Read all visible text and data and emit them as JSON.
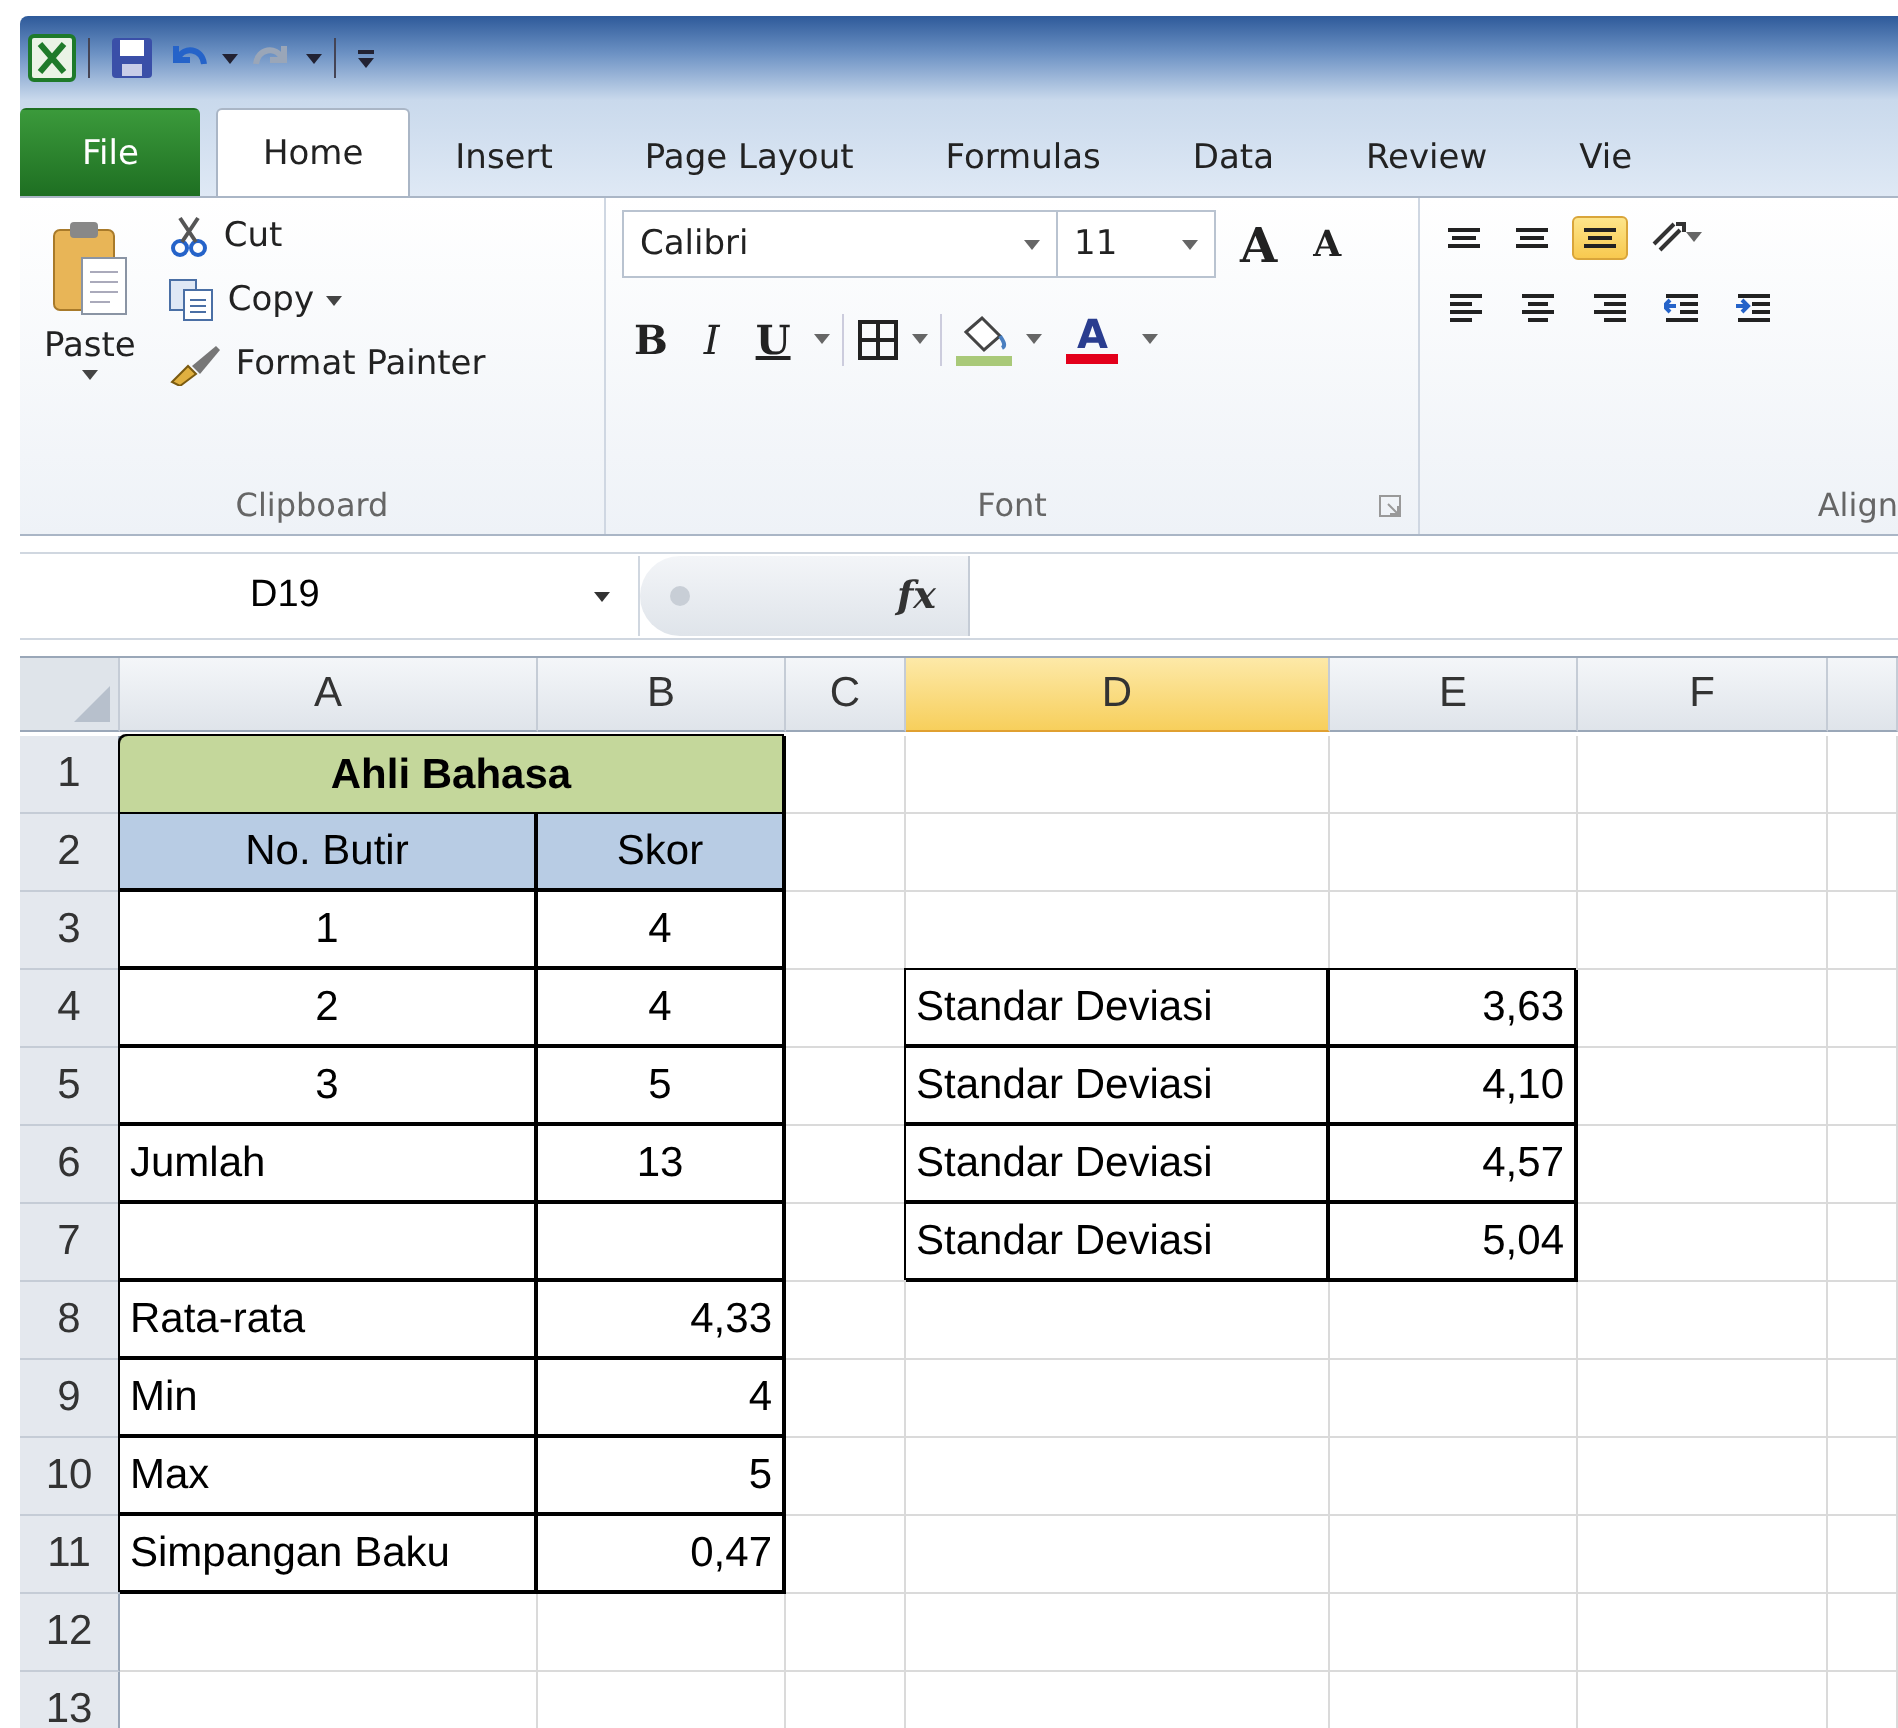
{
  "quick_access": [
    {
      "kind": "app"
    },
    {
      "kind": "save"
    },
    {
      "kind": "undo"
    },
    {
      "kind": "dropdown"
    },
    {
      "kind": "redo"
    },
    {
      "kind": "dropdown"
    },
    {
      "kind": "customize"
    }
  ],
  "tabs": [
    {
      "label": "File",
      "kind": "file",
      "selected": false
    },
    {
      "label": "Home",
      "kind": "tab",
      "selected": true
    },
    {
      "label": "Insert",
      "kind": "tab",
      "selected": false
    },
    {
      "label": "Page Layout",
      "kind": "tab",
      "selected": false
    },
    {
      "label": "Formulas",
      "kind": "tab",
      "selected": false
    },
    {
      "label": "Data",
      "kind": "tab",
      "selected": false
    },
    {
      "label": "Review",
      "kind": "tab",
      "selected": false
    },
    {
      "label": "Vie",
      "kind": "tab",
      "selected": false
    }
  ],
  "clipboard": {
    "title": "Clipboard",
    "paste": "Paste",
    "items": [
      {
        "kind": "cut",
        "label": "Cut"
      },
      {
        "kind": "copy",
        "label": "Copy"
      },
      {
        "kind": "painter",
        "label": "Format Painter"
      }
    ]
  },
  "font": {
    "title": "Font",
    "name": "Calibri",
    "size": "11",
    "grow": "A",
    "shrink": "A",
    "bold": "B",
    "italic": "I",
    "underline": "U",
    "color_label": "A"
  },
  "alignment": {
    "title": "Align",
    "top_row": [
      {
        "kind": "top",
        "on": false
      },
      {
        "kind": "middle",
        "on": false
      },
      {
        "kind": "bottom",
        "on": true
      },
      {
        "kind": "orientation",
        "on": false
      }
    ],
    "bottom_row": [
      {
        "kind": "left",
        "on": false
      },
      {
        "kind": "center",
        "on": false
      },
      {
        "kind": "right",
        "on": false
      },
      {
        "kind": "outdent",
        "on": false
      },
      {
        "kind": "indent",
        "on": false
      }
    ]
  },
  "formula_bar": {
    "name_box": "D19",
    "function_label": "fx"
  },
  "sheet": {
    "columns": [
      {
        "label": "A",
        "selected": false
      },
      {
        "label": "B",
        "selected": false
      },
      {
        "label": "C",
        "selected": false
      },
      {
        "label": "D",
        "selected": true
      },
      {
        "label": "E",
        "selected": false
      },
      {
        "label": "F",
        "selected": false
      },
      {
        "selected": false
      }
    ],
    "rows": [
      {
        "number": "1",
        "cells": [
          {
            "kind": "title",
            "text": "Ahli Bahasa",
            "centered": true,
            "merged": true
          },
          {
            "kind": "plain"
          },
          {
            "kind": "plain"
          },
          {
            "kind": "plain"
          },
          {
            "kind": "plain"
          },
          {
            "kind": "plain"
          }
        ]
      },
      {
        "number": "2",
        "cells": [
          {
            "kind": "header",
            "text": "No. Butir",
            "centered": true
          },
          {
            "kind": "header",
            "text": "Skor",
            "centered": true
          },
          {
            "kind": "plain"
          },
          {
            "kind": "plain"
          },
          {
            "kind": "plain"
          },
          {
            "kind": "plain"
          },
          {
            "kind": "plain"
          }
        ]
      },
      {
        "number": "3",
        "cells": [
          {
            "kind": "boxed",
            "text": "1",
            "centered": true
          },
          {
            "kind": "boxed",
            "text": "4",
            "centered": true
          },
          {
            "kind": "plain"
          },
          {
            "kind": "plain"
          },
          {
            "kind": "plain"
          },
          {
            "kind": "plain"
          },
          {
            "kind": "plain"
          }
        ]
      },
      {
        "number": "4",
        "cells": [
          {
            "kind": "boxed",
            "text": "2",
            "centered": true
          },
          {
            "kind": "boxed",
            "text": "4",
            "centered": true
          },
          {
            "kind": "plain"
          },
          {
            "kind": "boxed",
            "text": "Standar Deviasi"
          },
          {
            "kind": "boxed",
            "text": "3,63",
            "right_aligned": true
          },
          {
            "kind": "plain"
          },
          {
            "kind": "plain"
          }
        ]
      },
      {
        "number": "5",
        "cells": [
          {
            "kind": "boxed",
            "text": "3",
            "centered": true
          },
          {
            "kind": "boxed",
            "text": "5",
            "centered": true
          },
          {
            "kind": "plain"
          },
          {
            "kind": "boxed",
            "text": "Standar Deviasi"
          },
          {
            "kind": "boxed",
            "text": "4,10",
            "right_aligned": true
          },
          {
            "kind": "plain"
          },
          {
            "kind": "plain"
          }
        ]
      },
      {
        "number": "6",
        "cells": [
          {
            "kind": "boxed",
            "text": "Jumlah"
          },
          {
            "kind": "boxed",
            "text": "13",
            "centered": true
          },
          {
            "kind": "plain"
          },
          {
            "kind": "boxed",
            "text": "Standar Deviasi"
          },
          {
            "kind": "boxed",
            "text": "4,57",
            "right_aligned": true
          },
          {
            "kind": "plain"
          },
          {
            "kind": "plain"
          }
        ]
      },
      {
        "number": "7",
        "cells": [
          {
            "kind": "boxed"
          },
          {
            "kind": "boxed"
          },
          {
            "kind": "plain"
          },
          {
            "kind": "boxed",
            "text": "Standar Deviasi"
          },
          {
            "kind": "boxed",
            "text": "5,04",
            "right_aligned": true
          },
          {
            "kind": "plain"
          },
          {
            "kind": "plain"
          }
        ]
      },
      {
        "number": "8",
        "cells": [
          {
            "kind": "boxed",
            "text": "Rata-rata"
          },
          {
            "kind": "boxed",
            "text": "4,33",
            "right_aligned": true
          },
          {
            "kind": "plain"
          },
          {
            "kind": "plain"
          },
          {
            "kind": "plain"
          },
          {
            "kind": "plain"
          },
          {
            "kind": "plain"
          }
        ]
      },
      {
        "number": "9",
        "cells": [
          {
            "kind": "boxed",
            "text": "Min"
          },
          {
            "kind": "boxed",
            "text": "4",
            "right_aligned": true
          },
          {
            "kind": "plain"
          },
          {
            "kind": "plain"
          },
          {
            "kind": "plain"
          },
          {
            "kind": "plain"
          },
          {
            "kind": "plain"
          }
        ]
      },
      {
        "number": "10",
        "cells": [
          {
            "kind": "boxed",
            "text": "Max"
          },
          {
            "kind": "boxed",
            "text": "5",
            "right_aligned": true
          },
          {
            "kind": "plain"
          },
          {
            "kind": "plain"
          },
          {
            "kind": "plain"
          },
          {
            "kind": "plain"
          },
          {
            "kind": "plain"
          }
        ]
      },
      {
        "number": "11",
        "cells": [
          {
            "kind": "boxed",
            "text": "Simpangan Baku"
          },
          {
            "kind": "boxed",
            "text": "0,47",
            "right_aligned": true
          },
          {
            "kind": "plain"
          },
          {
            "kind": "plain"
          },
          {
            "kind": "plain"
          },
          {
            "kind": "plain"
          },
          {
            "kind": "plain"
          }
        ]
      },
      {
        "number": "12",
        "cells": [
          {
            "kind": "plain"
          },
          {
            "kind": "plain"
          },
          {
            "kind": "plain"
          },
          {
            "kind": "plain"
          },
          {
            "kind": "plain"
          },
          {
            "kind": "plain"
          },
          {
            "kind": "plain"
          }
        ]
      },
      {
        "number": "13",
        "cells": [
          {
            "kind": "plain"
          },
          {
            "kind": "plain"
          },
          {
            "kind": "plain"
          },
          {
            "kind": "plain"
          },
          {
            "kind": "plain"
          },
          {
            "kind": "plain"
          },
          {
            "kind": "plain"
          }
        ]
      }
    ]
  }
}
